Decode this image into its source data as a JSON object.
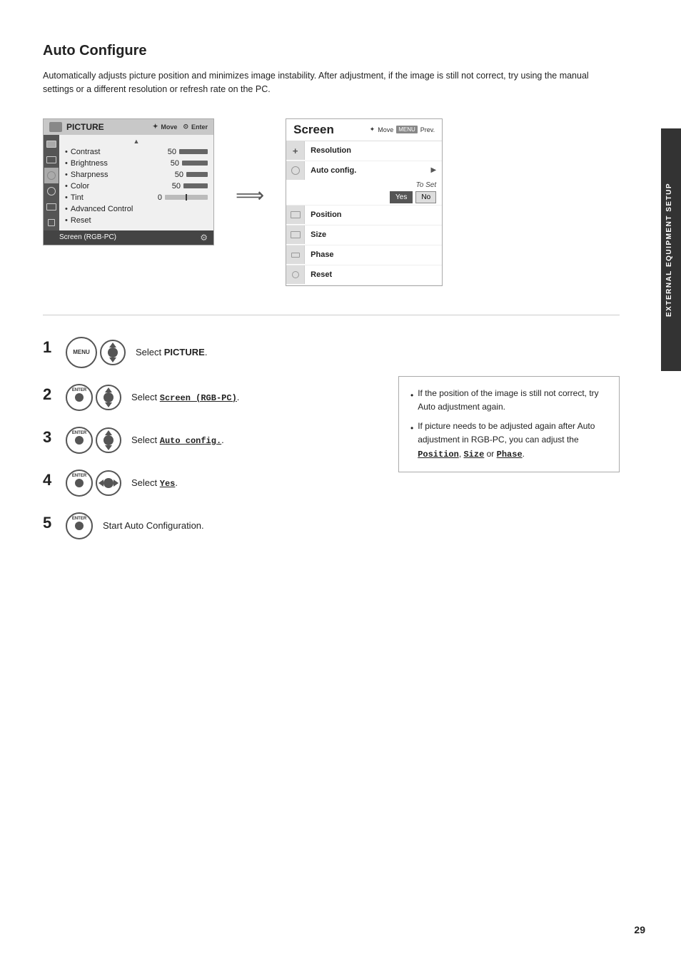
{
  "page": {
    "title": "Auto Configure",
    "description": "Automatically adjusts picture position and minimizes image instability. After adjustment, if the image is still not correct, try using the manual settings or a different resolution or refresh rate on the PC.",
    "side_tab": "EXTERNAL EQUIPMENT SETUP",
    "page_number": "29"
  },
  "left_panel": {
    "title": "PICTURE",
    "nav_text": "Move",
    "enter_text": "Enter",
    "items": [
      {
        "label": "Contrast",
        "value": "50",
        "bar": true
      },
      {
        "label": "Brightness",
        "value": "50",
        "bar": true
      },
      {
        "label": "Sharpness",
        "value": "50",
        "bar": true
      },
      {
        "label": "Color",
        "value": "50",
        "bar": true
      },
      {
        "label": "Tint",
        "value": "0",
        "bar": false
      },
      {
        "label": "Advanced Control",
        "value": "",
        "bar": false
      },
      {
        "label": "Reset",
        "value": "",
        "bar": false
      }
    ],
    "bottom_label": "Screen (RGB-PC)"
  },
  "right_panel": {
    "title": "Screen",
    "nav_text": "Move",
    "menu_text": "MENU",
    "prev_text": "Prev.",
    "items": [
      {
        "label": "Resolution",
        "icon": "plus",
        "has_arrow": false
      },
      {
        "label": "Auto config.",
        "icon": "circle",
        "has_arrow": true
      },
      {
        "label": "Position",
        "icon": "rect",
        "has_arrow": false
      },
      {
        "label": "Size",
        "icon": "rect",
        "has_arrow": false
      },
      {
        "label": "Phase",
        "icon": "rect-small",
        "has_arrow": false
      },
      {
        "label": "Reset",
        "icon": "circle-small",
        "has_arrow": false
      }
    ],
    "to_set_label": "To Set",
    "yes_label": "Yes",
    "no_label": "No"
  },
  "steps": [
    {
      "number": "1",
      "button_type": "menu",
      "text": "Select ",
      "bold_text": "PICTURE",
      "suffix": "."
    },
    {
      "number": "2",
      "button_type": "enter-nav",
      "text": "Select ",
      "underline_text": "Screen (RGB-PC)",
      "suffix": "."
    },
    {
      "number": "3",
      "button_type": "enter-nav",
      "text": "Select ",
      "underline_text": "Auto config.",
      "suffix": "."
    },
    {
      "number": "4",
      "button_type": "enter-lr",
      "text": "Select ",
      "bold_text": "Yes",
      "suffix": "."
    },
    {
      "number": "5",
      "button_type": "enter-only",
      "text": "Start Auto Configuration."
    }
  ],
  "notes": [
    "If the position of the image is still not correct, try Auto adjustment again.",
    "If picture needs to be adjusted again after Auto adjustment in RGB-PC, you can adjust the Position, Size or Phase."
  ],
  "note_keywords": [
    "Position,",
    "Size",
    "Phase"
  ]
}
